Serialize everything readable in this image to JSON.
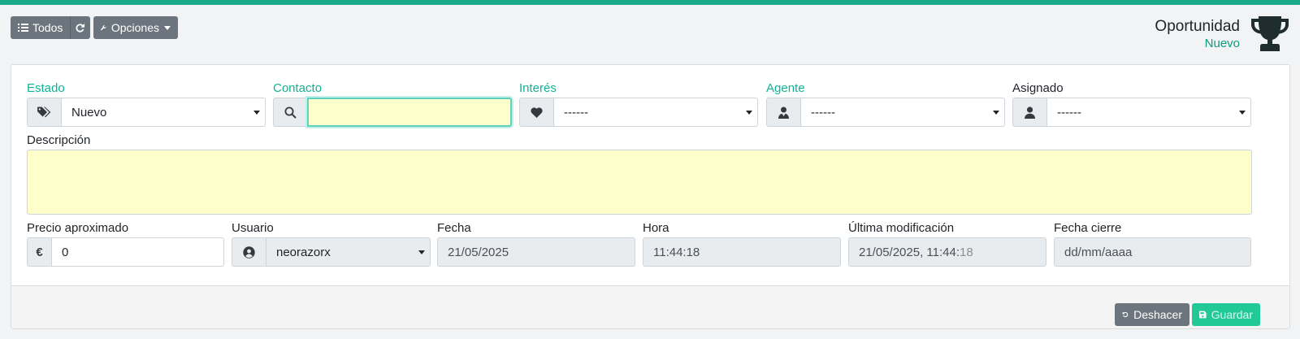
{
  "toolbar": {
    "all_label": "Todos",
    "options_label": "Opciones"
  },
  "header": {
    "title": "Oportunidad",
    "status": "Nuevo"
  },
  "form": {
    "estado": {
      "label": "Estado",
      "value": "Nuevo"
    },
    "contacto": {
      "label": "Contacto",
      "value": ""
    },
    "interes": {
      "label": "Interés",
      "value": "------"
    },
    "agente": {
      "label": "Agente",
      "value": "------"
    },
    "asignado": {
      "label": "Asignado",
      "value": "------"
    },
    "descripcion": {
      "label": "Descripción",
      "value": ""
    },
    "precio": {
      "label": "Precio aproximado",
      "currency": "€",
      "value": "0"
    },
    "usuario": {
      "label": "Usuario",
      "value": "neorazorx"
    },
    "fecha": {
      "label": "Fecha",
      "value": "21/05/2025"
    },
    "hora": {
      "label": "Hora",
      "value": "11:44:18"
    },
    "ultima_mod": {
      "label": "Última modificación",
      "value_main": "21/05/2025, 11:44:",
      "value_dim": "18"
    },
    "fecha_cierre": {
      "label": "Fecha cierre",
      "value": "dd/mm/aaaa"
    }
  },
  "footer": {
    "undo_label": "Deshacer",
    "save_label": "Guardar"
  },
  "colors": {
    "accent": "#1aaa8c",
    "label_green": "#10b296",
    "button_grey": "#6c757d",
    "save_green": "#20c997",
    "field_highlight": "#ffffcc"
  }
}
